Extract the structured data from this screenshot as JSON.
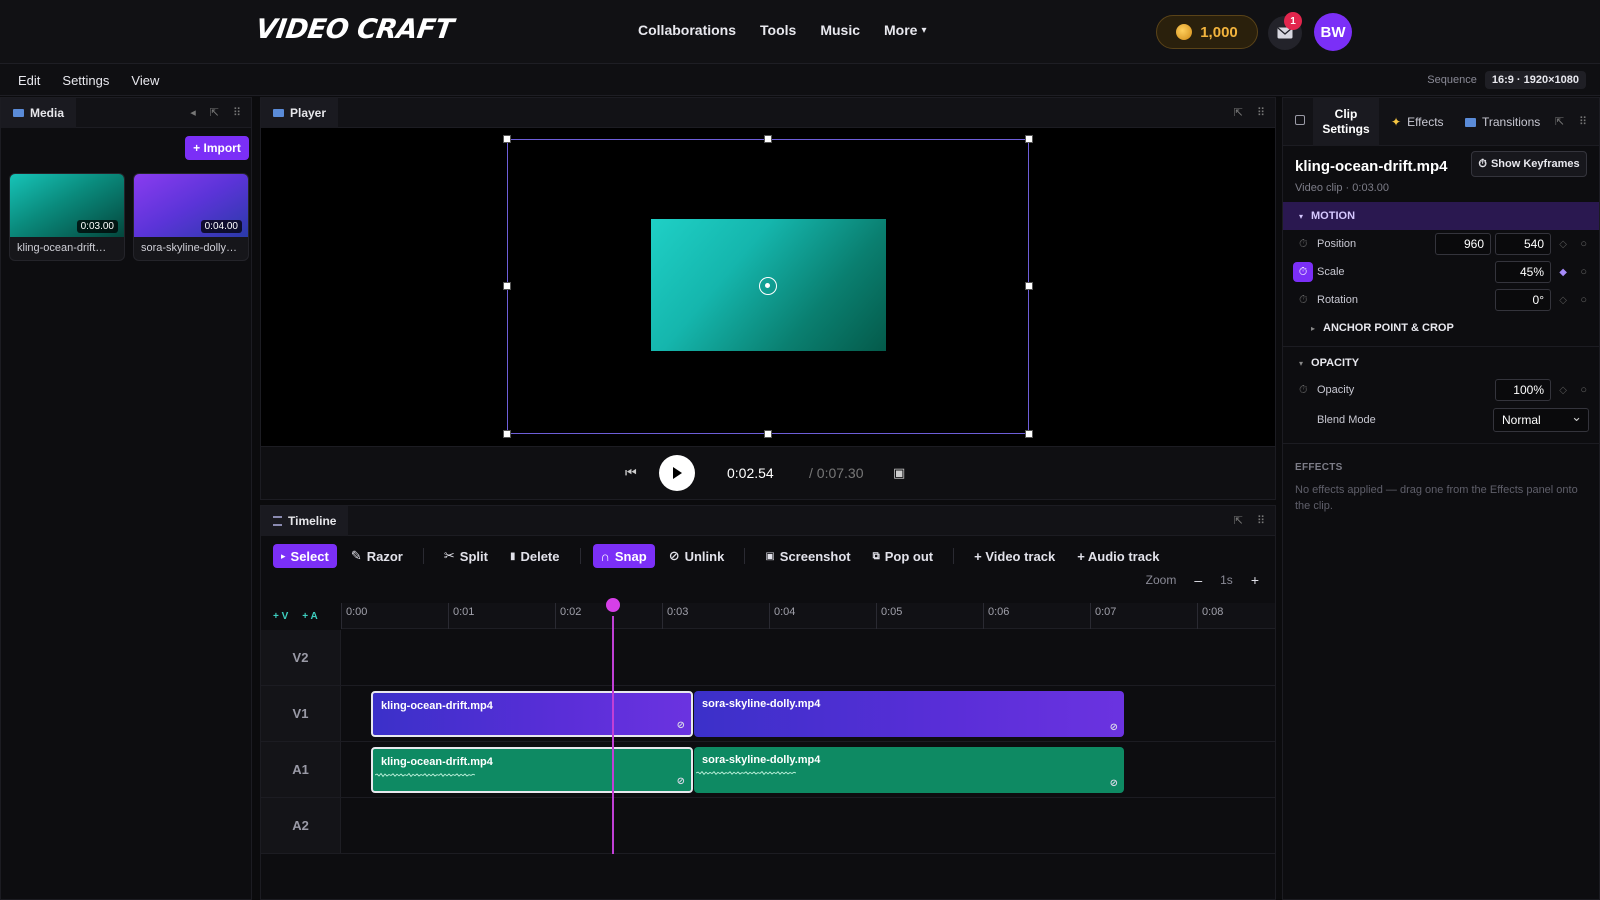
{
  "app": {
    "logo": "VIDEO CRAFT"
  },
  "topnav": {
    "items": [
      "Collaborations",
      "Tools",
      "Music",
      "More"
    ]
  },
  "account": {
    "coins": "1,000",
    "notifications": "1",
    "initials": "BW"
  },
  "menu": {
    "items": [
      "Edit",
      "Settings",
      "View"
    ],
    "sequence_label": "Sequence",
    "sequence_value": "16:9 · 1920×1080"
  },
  "media": {
    "title": "Media",
    "import_label": "+ Import",
    "items": [
      {
        "name": "kling-ocean-drift…",
        "duration": "0:03.00"
      },
      {
        "name": "sora-skyline-dolly…",
        "duration": "0:04.00"
      }
    ]
  },
  "player": {
    "title": "Player",
    "current_time": "0:02.54",
    "total_time": "/ 0:07.30"
  },
  "timeline": {
    "title": "Timeline",
    "tools": [
      "Select",
      "Razor",
      "Split",
      "Delete",
      "Snap",
      "Unlink",
      "Screenshot",
      "Pop out",
      "+ Video track",
      "+ Audio track"
    ],
    "zoom_label": "Zoom",
    "zoom_value": "1s",
    "zoom_minus": "–",
    "zoom_plus": "+",
    "add_video": "+ V",
    "add_audio": "+ A",
    "ticks": [
      "0:00",
      "0:01",
      "0:02",
      "0:03",
      "0:04",
      "0:05",
      "0:06",
      "0:07",
      "0:08"
    ],
    "tracks": [
      "V2",
      "V1",
      "A1",
      "A2"
    ],
    "clips": {
      "v1_a": "kling-ocean-drift.mp4",
      "v1_b": "sora-skyline-dolly.mp4",
      "a1_a": "kling-ocean-drift.mp4",
      "a1_b": "sora-skyline-dolly.mp4"
    }
  },
  "inspector": {
    "tabs": [
      "Clip\nSettings",
      "Effects",
      "Transitions"
    ],
    "clip_name": "kling-ocean-drift.mp4",
    "clip_meta": "Video clip · 0:03.00",
    "keyframes_label": "Show Keyframes",
    "motion_label": "MOTION",
    "position_label": "Position",
    "position_x": "960",
    "position_y": "540",
    "scale_label": "Scale",
    "scale_value": "45%",
    "rotation_label": "Rotation",
    "rotation_value": "0°",
    "anchor_label": "ANCHOR POINT & CROP",
    "opacity_section": "OPACITY",
    "opacity_label": "Opacity",
    "opacity_value": "100%",
    "blend_label": "Blend Mode",
    "blend_value": "Normal",
    "effects_label": "EFFECTS",
    "effects_empty": "No effects applied — drag one from the Effects panel onto the clip."
  },
  "colors": {
    "accent": "#7b2ff7",
    "playhead": "#c13fd6",
    "video_clip": "#4b2fd3",
    "audio_clip": "#0e8a63",
    "coin": "#f2b33d"
  }
}
